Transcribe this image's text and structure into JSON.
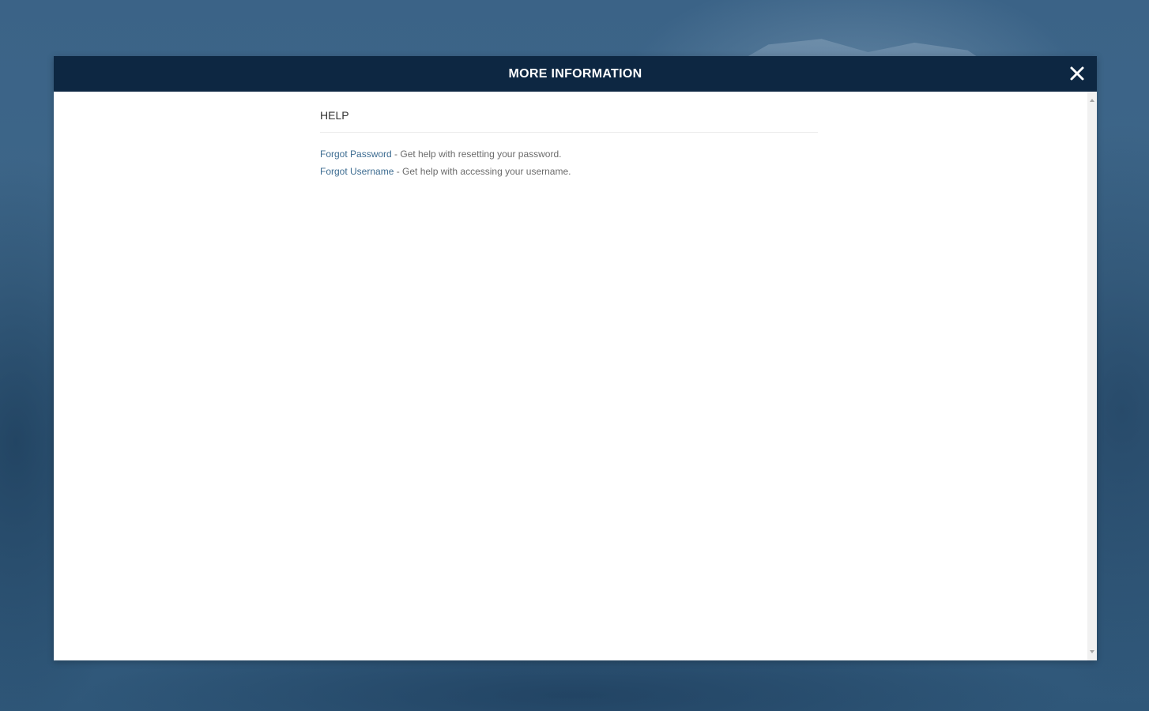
{
  "modal": {
    "title": "MORE INFORMATION",
    "close_icon": "close-icon"
  },
  "help": {
    "heading": "HELP",
    "items": [
      {
        "link_label": "Forgot Password",
        "description": " - Get help with resetting your password."
      },
      {
        "link_label": "Forgot Username",
        "description": " - Get help with accessing your username."
      }
    ]
  },
  "colors": {
    "header_bg": "#0d2742",
    "page_bg": "#3a6184",
    "link": "#3d6c91"
  }
}
